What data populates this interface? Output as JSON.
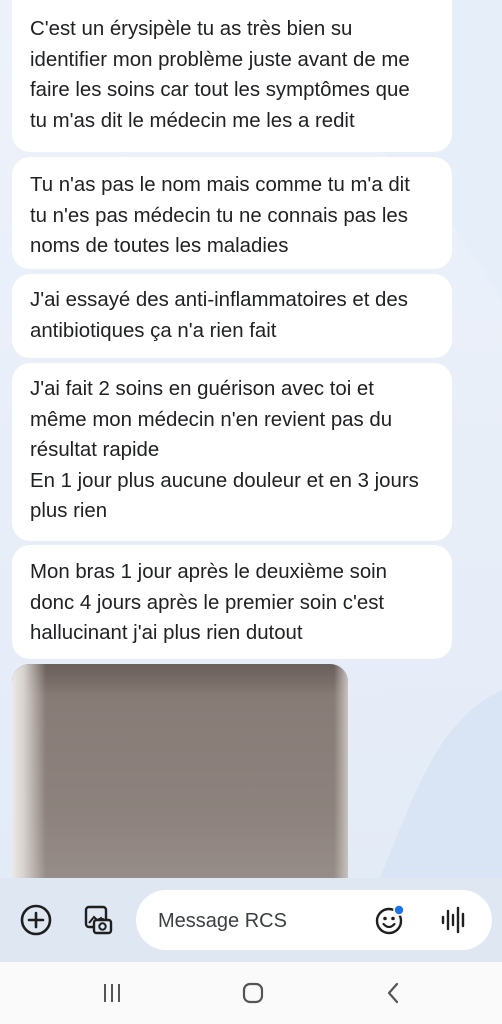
{
  "messages": [
    {
      "text": "C'est un érysipèle tu as très bien su\nidentifier mon problème juste avant de me\nfaire les soins car tout les symptômes que\ntu m'as dit le médecin me les a redit"
    },
    {
      "text": "Tu n'as pas le nom mais comme tu m'a dit\ntu n'es pas médecin tu ne connais pas les\nnoms de toutes les maladies"
    },
    {
      "text": "J'ai essayé des anti-inflammatoires et des\nantibiotiques ça n'a rien fait"
    },
    {
      "text": "J'ai fait 2 soins en guérison avec toi et\nmême mon médecin n'en revient pas du\nrésultat rapide\nEn 1 jour plus aucune douleur et en 3 jours\nplus rien"
    },
    {
      "text": "Mon bras 1 jour après le deuxième soin\ndonc 4 jours après le premier soin c'est\nhallucinant j'ai plus rien dutout"
    }
  ],
  "photo": {
    "icon": "photo-attachment"
  },
  "composer": {
    "placeholder": "Message RCS",
    "value": "",
    "icons": [
      "add-circle-icon",
      "gallery-icon",
      "emoji-icon",
      "voice-wave-icon"
    ],
    "accent_color": "#1a73e8"
  },
  "navbar": {
    "icons": [
      "recents-icon",
      "home-icon",
      "back-icon"
    ]
  },
  "colors": {
    "background": "#e8eef8",
    "bubble": "#ffffff",
    "text": "#202124",
    "composer_bar": "#dfe7f3"
  }
}
